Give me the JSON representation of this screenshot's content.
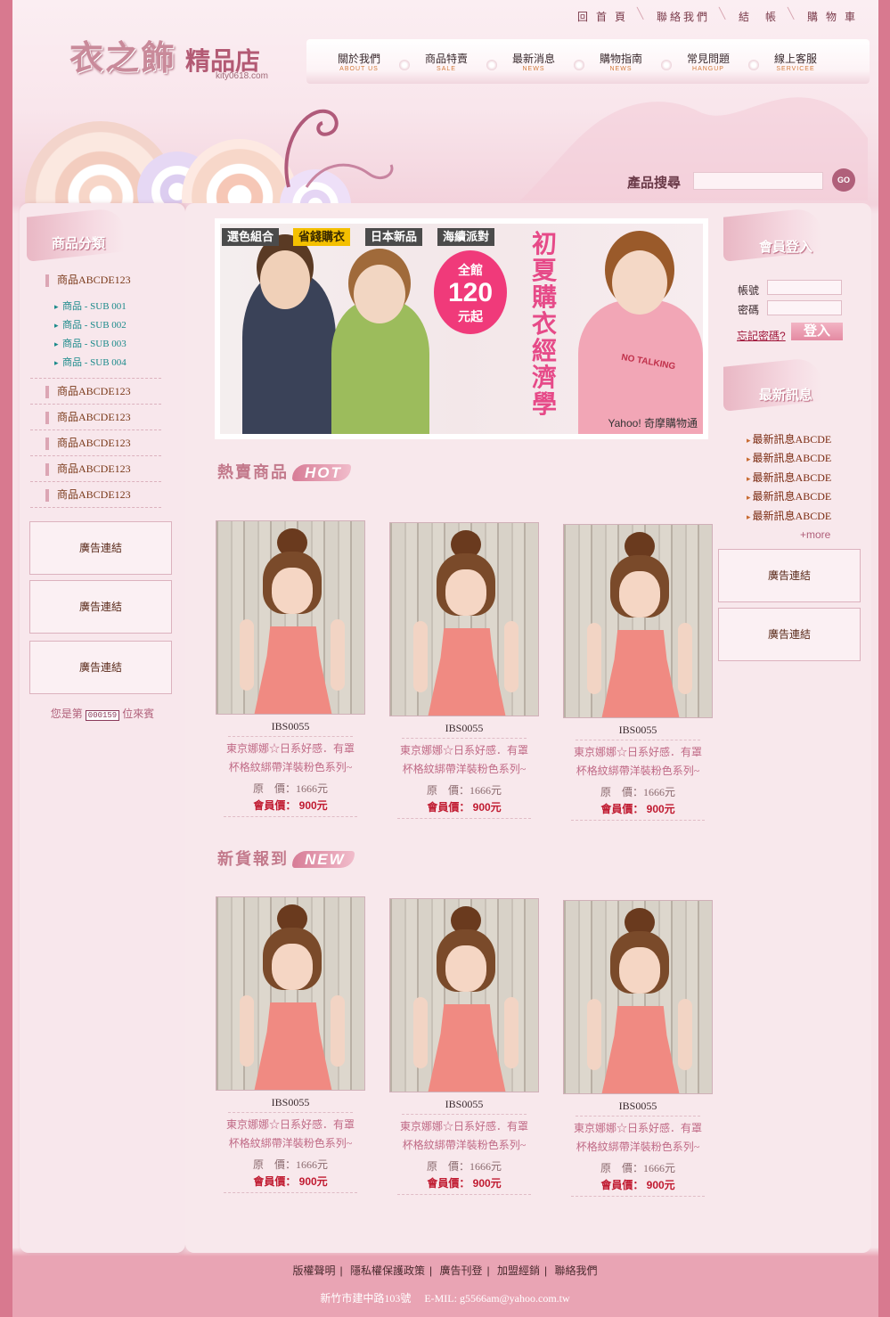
{
  "header": {
    "logo_main": "衣之飾",
    "logo_sub": "精品店",
    "logo_url": "kity0618.com",
    "top_links": [
      "回 首 頁",
      "聯絡我們",
      "結　帳",
      "購 物 車"
    ],
    "nav": [
      {
        "zh": "關於我們",
        "en": "ABOUT US"
      },
      {
        "zh": "商品特賣",
        "en": "SALE"
      },
      {
        "zh": "最新消息",
        "en": "NEWS"
      },
      {
        "zh": "購物指南",
        "en": "NEWS"
      },
      {
        "zh": "常見問題",
        "en": "HANGUP"
      },
      {
        "zh": "線上客服",
        "en": "SERVICEE"
      }
    ],
    "search_label": "產品搜尋",
    "search_button": "GO"
  },
  "left": {
    "title": "商品分類",
    "categories": [
      "商品ABCDE123",
      "商品ABCDE123",
      "商品ABCDE123",
      "商品ABCDE123",
      "商品ABCDE123",
      "商品ABCDE123"
    ],
    "subs": [
      "商品 - SUB 001",
      "商品 - SUB 002",
      "商品 - SUB 003",
      "商品 - SUB 004"
    ],
    "ads": [
      "廣告連結",
      "廣告連結",
      "廣告連結"
    ],
    "visitor_prefix": "您是第",
    "visitor_count": "000159",
    "visitor_suffix": "位來賓"
  },
  "banner": {
    "tags": [
      "選色組合",
      "省錢購衣",
      "日本新品",
      "海續派對"
    ],
    "badge_a": "全館",
    "badge_b": "120",
    "badge_c": "元起",
    "slogan_col1": "初夏購",
    "slogan_col2": "衣經濟學",
    "brand": "Yahoo! 奇摩購物通",
    "shirt_text": "NO TALKING"
  },
  "hot": {
    "title": "熱賣商品",
    "en": "HOT",
    "items": [
      {
        "code": "IBS0055",
        "desc1": "東京娜娜☆日系好感．有罩",
        "desc2": "杯格紋綁帶洋裝粉色系列~",
        "price": "原　價：1666元",
        "member": "會員價： 900元"
      },
      {
        "code": "IBS0055",
        "desc1": "東京娜娜☆日系好感．有罩",
        "desc2": "杯格紋綁帶洋裝粉色系列~",
        "price": "原　價：1666元",
        "member": "會員價： 900元"
      },
      {
        "code": "IBS0055",
        "desc1": "東京娜娜☆日系好感．有罩",
        "desc2": "杯格紋綁帶洋裝粉色系列~",
        "price": "原　價：1666元",
        "member": "會員價： 900元"
      }
    ]
  },
  "new": {
    "title": "新貨報到",
    "en": "NEW",
    "items": [
      {
        "code": "IBS0055",
        "desc1": "東京娜娜☆日系好感．有罩",
        "desc2": "杯格紋綁帶洋裝粉色系列~",
        "price": "原　價：1666元",
        "member": "會員價： 900元"
      },
      {
        "code": "IBS0055",
        "desc1": "東京娜娜☆日系好感．有罩",
        "desc2": "杯格紋綁帶洋裝粉色系列~",
        "price": "原　價：1666元",
        "member": "會員價： 900元"
      },
      {
        "code": "IBS0055",
        "desc1": "東京娜娜☆日系好感．有罩",
        "desc2": "杯格紋綁帶洋裝粉色系列~",
        "price": "原　價：1666元",
        "member": "會員價： 900元"
      }
    ]
  },
  "right": {
    "login_title": "會員登入",
    "account_label": "帳號",
    "password_label": "密碼",
    "forgot": "忘記密碼?",
    "login_button": "登入",
    "news_title": "最新訊息",
    "news": [
      "最新訊息ABCDE",
      "最新訊息ABCDE",
      "最新訊息ABCDE",
      "最新訊息ABCDE",
      "最新訊息ABCDE"
    ],
    "more": "+more",
    "ads": [
      "廣告連結",
      "廣告連結"
    ]
  },
  "footer": {
    "links": [
      "版權聲明",
      "隱私權保護政策",
      "廣告刊登",
      "加盟經銷",
      "聯絡我們"
    ],
    "address": "新竹市建中路103號　 E-MIL: g5566am@yahoo.com.tw"
  },
  "colors": {
    "accent": "#b0607a",
    "page_bg": "#d8798f",
    "price_red": "#c01a30"
  }
}
